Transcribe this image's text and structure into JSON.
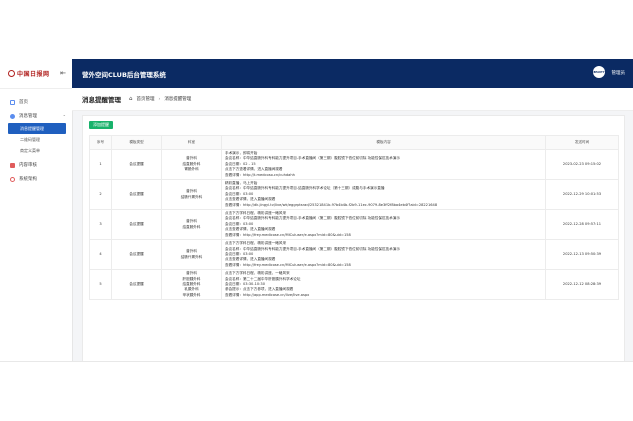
{
  "logo": {
    "text": "中国日报网"
  },
  "header": {
    "title": "营外空间CLUB后台管理系统",
    "avatar_text": "BEAUTY",
    "username": "管理员"
  },
  "sidebar": {
    "items": [
      {
        "label": "首页",
        "color": "#5b8def"
      },
      {
        "label": "消息管理",
        "color": "#5b8def",
        "expanded": true
      },
      {
        "label": "内容审核",
        "color": "#e05c5c"
      },
      {
        "label": "系统架构",
        "color": "#e05c5c"
      }
    ],
    "sub_items": [
      {
        "label": "消息提醒管理",
        "active": true
      },
      {
        "label": "二维码管理",
        "active": false
      },
      {
        "label": "商定义菜单",
        "active": false
      }
    ]
  },
  "page": {
    "title": "消息提醒管理",
    "breadcrumb": [
      "首页管理",
      "消息提醒管理"
    ]
  },
  "toolbar": {
    "add_label": "添加提醒",
    "add_color": "#18b26b"
  },
  "table": {
    "headers": [
      "序号",
      "模板类型",
      "科室",
      "模板内容",
      "发送时间"
    ],
    "rows": [
      {
        "index": "1",
        "type": "会议提醒",
        "depts": [
          "普外科",
          "结直肠外科",
          "胃肠外科"
        ],
        "content": [
          "手术演示，即将开始",
          "会议名称：中华结直肠外科专科能力提升项目-手术直播间（第三期）腹腔镜下低位前切除 功能性保肛技术演示",
          "会议日期：02 - 15",
          "点击下方查看详情，进入直播间观看",
          "查看详情：http://t.medcoso.cn/cuhdahh"
        ],
        "time": "2023-02-23 09:15:02"
      },
      {
        "index": "2",
        "type": "会议提醒",
        "depts": [
          "普外科",
          "结肠代胃外科"
        ],
        "content": [
          "精彩直播，马上开始",
          "会议名称：中华结直肠外科专科能力提升项目-结直肠外科学术论坛（第十三期）成腹与手术演示直播",
          "会议日期：03:00",
          "点击查看详情，进入直播间观看",
          "查看详情：http://dk.jingyi.tv/live/wk/eggrptsrad/25321841b-9?b4b4b-f2b9-11ec-9079-8e3ff2f8ba4eb4f?aid=28221648"
        ],
        "time": "2022-12-29 10:01:53"
      },
      {
        "index": "3",
        "type": "会议提醒",
        "depts": [
          "普外科",
          "结直肠外科"
        ],
        "content": [
          "点击下方学科日程，精彩讲座一睹风采",
          "会议名称：中华结直肠外科专科能力提升项目-手术直播间（第二期）腹腔镜下低位前切除 功能性保肛技术演示",
          "会议日期：03:00",
          "点击查看详情，进入直播间观看",
          "查看详情：http://frey.medicose.cn/MICuluser/e.aspx?mid=80&uid=158"
        ],
        "time": "2022-12-28 09:57:11"
      },
      {
        "index": "4",
        "type": "会议提醒",
        "depts": [
          "普外科",
          "结肠代胃外科"
        ],
        "content": [
          "点击下方学科日程，精彩讲座一睹风采",
          "会议名称：中华结直肠外科专科能力提升项目-手术直播间（第二期）腹腔镜下低位前切除 功能性保肛技术演示",
          "会议日期：03:00",
          "点击查看详情，进入直播间观看",
          "查看详情：http://frey.medicose.cn/MICuluser/e.aspx?mid=80&uid=158"
        ],
        "time": "2022-12-13 09:50:39"
      },
      {
        "index": "5",
        "type": "会议提醒",
        "depts": [
          "普外科",
          "肝胆胰外科",
          "结直肠外科",
          "乳腺外科",
          "甲状腺外科"
        ],
        "content": [
          "点击下方学科日程，精彩讲座，一睹风采",
          "会议名称：第二十二届中华肝胆胰外科学术论坛",
          "会议日期：03:30-10:30",
          "参会提示：点击下方参项，进入直播间观看",
          "查看详情：http://app.medicose.cn/live/live.aspx"
        ],
        "time": "2022-12-12 08:28:39"
      }
    ]
  }
}
